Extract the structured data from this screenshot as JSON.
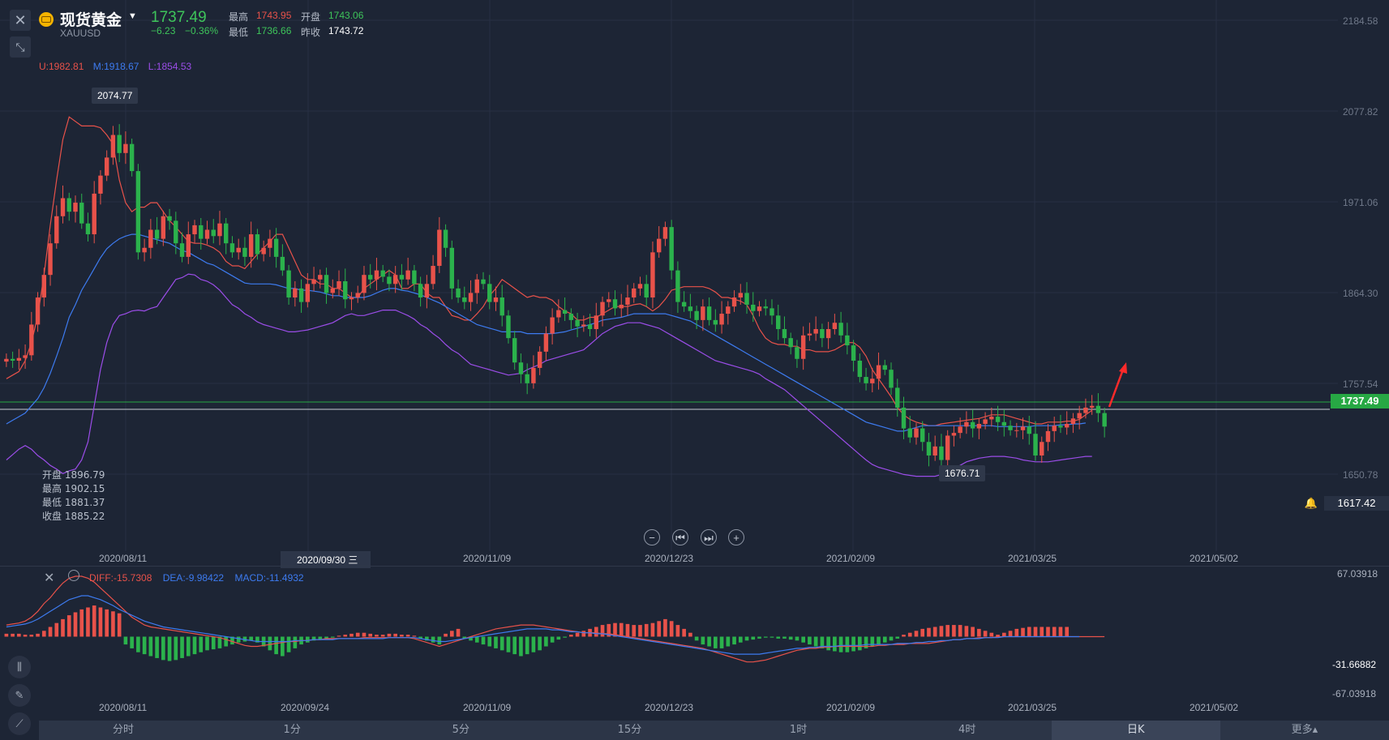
{
  "header": {
    "title": "现货黄金",
    "symbol": "XAUUSD",
    "price": "1737.49",
    "change": "−6.23",
    "change_pct": "−0.36%",
    "stats": [
      {
        "label": "最高",
        "value": "1743.95",
        "color": "#e8524a"
      },
      {
        "label": "开盘",
        "value": "1743.06",
        "color": "#3ec45a"
      },
      {
        "label": "最低",
        "value": "1736.66",
        "color": "#3ec45a"
      },
      {
        "label": "昨收",
        "value": "1743.72",
        "color": "#ffffff"
      }
    ]
  },
  "boll": {
    "upper": "U:1982.81",
    "mid": "M:1918.67",
    "lower": "L:1854.53",
    "colors": {
      "upper": "#e8524a",
      "mid": "#3d7bf0",
      "lower": "#9b4de8"
    }
  },
  "ohlc": {
    "open": "开盘 1896.79",
    "high": "最高 1902.15",
    "low": "最低 1881.37",
    "close": "收盘 1885.22"
  },
  "callouts": {
    "high": "2074.77",
    "low": "1676.71"
  },
  "price_tag": "1737.49",
  "alert_price": "1617.42",
  "y_axis": [
    "2184.58",
    "2077.82",
    "1971.06",
    "1864.30",
    "1757.54",
    "1650.78"
  ],
  "x_axis": [
    "2020/08/11",
    "2020/09/30 三",
    "2020/11/09",
    "2020/12/23",
    "2021/02/09",
    "2021/03/25",
    "2021/05/02"
  ],
  "macd": {
    "diff": "DIFF:-15.7308",
    "dea": "DEA:-9.98422",
    "macd": "MACD:-11.4932",
    "y_axis": [
      "67.03918",
      "-31.66882",
      "-67.03918"
    ],
    "x_axis": [
      "2020/08/11",
      "2020/09/24",
      "2020/11/09",
      "2020/12/23",
      "2021/02/09",
      "2021/03/25",
      "2021/05/02"
    ]
  },
  "tabs": [
    "分时",
    "1分",
    "5分",
    "15分",
    "1时",
    "4时",
    "日K",
    "更多▴"
  ],
  "active_tab": "日K",
  "colors": {
    "up": "#e8524a",
    "down": "#2bb24c",
    "background": "#1d2535"
  },
  "chart_data": {
    "type": "candlestick",
    "ylim": [
      1617,
      2205
    ],
    "closes": [
      1812,
      1810,
      1813,
      1816,
      1850,
      1880,
      1905,
      1940,
      1970,
      1990,
      1975,
      1985,
      1962,
      1950,
      1995,
      2015,
      2035,
      2060,
      2040,
      2050,
      2020,
      1930,
      1935,
      1955,
      1945,
      1970,
      1965,
      1940,
      1925,
      1950,
      1960,
      1945,
      1955,
      1948,
      1962,
      1940,
      1930,
      1935,
      1925,
      1950,
      1928,
      1935,
      1945,
      1925,
      1910,
      1880,
      1890,
      1875,
      1895,
      1900,
      1905,
      1885,
      1890,
      1898,
      1878,
      1880,
      1885,
      1905,
      1900,
      1910,
      1903,
      1895,
      1905,
      1900,
      1910,
      1895,
      1880,
      1895,
      1915,
      1955,
      1935,
      1890,
      1880,
      1875,
      1885,
      1900,
      1895,
      1875,
      1880,
      1860,
      1835,
      1808,
      1795,
      1785,
      1802,
      1820,
      1840,
      1858,
      1866,
      1862,
      1855,
      1848,
      1850,
      1845,
      1860,
      1875,
      1878,
      1868,
      1872,
      1880,
      1890,
      1895,
      1880,
      1930,
      1945,
      1958,
      1910,
      1875,
      1870,
      1865,
      1855,
      1870,
      1855,
      1850,
      1862,
      1870,
      1880,
      1885,
      1872,
      1865,
      1870,
      1868,
      1860,
      1845,
      1835,
      1825,
      1812,
      1838,
      1840,
      1845,
      1835,
      1845,
      1852,
      1838,
      1827,
      1810,
      1792,
      1785,
      1790,
      1805,
      1800,
      1780,
      1758,
      1735,
      1725,
      1735,
      1720,
      1705,
      1715,
      1700,
      1727,
      1730,
      1737,
      1742,
      1735,
      1740,
      1745,
      1748,
      1742,
      1738,
      1733,
      1733,
      1737,
      1729,
      1705,
      1720,
      1732,
      1738,
      1736,
      1740,
      1746,
      1752,
      1758,
      1760,
      1752,
      1737
    ],
    "boll_upper": [
      1790,
      1794,
      1798,
      1810,
      1830,
      1860,
      1905,
      1960,
      2010,
      2055,
      2080,
      2075,
      2070,
      2070,
      2070,
      2068,
      2060,
      2050,
      2010,
      1985,
      1975,
      1980,
      1980,
      1985,
      1985,
      1975,
      1965,
      1958,
      1950,
      1942,
      1940,
      1940,
      1938,
      1935,
      1930,
      1920,
      1915,
      1915,
      1912,
      1920,
      1928,
      1935,
      1942,
      1950,
      1950,
      1935,
      1920,
      1905,
      1900,
      1900,
      1895,
      1895,
      1890,
      1890,
      1885,
      1880,
      1880,
      1890,
      1895,
      1900,
      1905,
      1910,
      1905,
      1890,
      1890,
      1895,
      1895,
      1885,
      1880,
      1880,
      1870,
      1860,
      1858,
      1855,
      1855,
      1862,
      1870,
      1882,
      1890,
      1900,
      1895,
      1890,
      1885,
      1880,
      1882,
      1880,
      1880,
      1877,
      1870,
      1865,
      1862,
      1855,
      1855,
      1858,
      1858,
      1862,
      1866,
      1870,
      1870,
      1870,
      1872,
      1873,
      1870,
      1865,
      1870,
      1878,
      1888,
      1890,
      1892,
      1892,
      1892,
      1892,
      1890,
      1886,
      1880,
      1880,
      1878,
      1876,
      1872,
      1860,
      1845,
      1835,
      1830,
      1828,
      1828,
      1826,
      1826,
      1822,
      1822,
      1820,
      1820,
      1820,
      1822,
      1826,
      1830,
      1830,
      1825,
      1815,
      1800,
      1790,
      1780,
      1770,
      1758,
      1750,
      1745,
      1742,
      1740,
      1738,
      1738,
      1740,
      1741,
      1742,
      1743,
      1744,
      1745,
      1746,
      1748,
      1750,
      1750,
      1750,
      1748,
      1746,
      1744,
      1742,
      1740,
      1740,
      1742,
      1742,
      1742,
      1743,
      1743,
      1745,
      1750,
      1755
    ],
    "boll_mid": [
      1740,
      1744,
      1748,
      1752,
      1760,
      1768,
      1780,
      1796,
      1815,
      1835,
      1858,
      1872,
      1888,
      1900,
      1912,
      1924,
      1934,
      1940,
      1945,
      1948,
      1950,
      1950,
      1948,
      1946,
      1944,
      1942,
      1940,
      1936,
      1932,
      1930,
      1926,
      1922,
      1918,
      1916,
      1912,
      1908,
      1904,
      1900,
      1896,
      1895,
      1895,
      1895,
      1895,
      1894,
      1892,
      1890,
      1890,
      1888,
      1888,
      1887,
      1886,
      1884,
      1882,
      1882,
      1880,
      1880,
      1880,
      1880,
      1882,
      1885,
      1888,
      1890,
      1890,
      1888,
      1887,
      1885,
      1883,
      1880,
      1877,
      1874,
      1870,
      1866,
      1862,
      1858,
      1854,
      1850,
      1848,
      1846,
      1844,
      1842,
      1842,
      1842,
      1842,
      1840,
      1840,
      1840,
      1840,
      1840,
      1841,
      1842,
      1844,
      1846,
      1848,
      1850,
      1852,
      1855,
      1856,
      1857,
      1858,
      1860,
      1862,
      1862,
      1862,
      1862,
      1862,
      1862,
      1860,
      1858,
      1856,
      1854,
      1850,
      1846,
      1842,
      1838,
      1834,
      1830,
      1826,
      1822,
      1818,
      1814,
      1810,
      1806,
      1802,
      1798,
      1794,
      1790,
      1786,
      1782,
      1778,
      1774,
      1770,
      1766,
      1762,
      1758,
      1754,
      1750,
      1746,
      1742,
      1740,
      1738,
      1736,
      1734,
      1732,
      1732,
      1734,
      1736,
      1738,
      1738,
      1738,
      1738,
      1738,
      1738,
      1738,
      1738,
      1738,
      1738,
      1738,
      1738,
      1737,
      1737,
      1737,
      1737,
      1737,
      1737,
      1738,
      1738,
      1738,
      1738,
      1739,
      1739,
      1740,
      1740,
      1741
    ],
    "boll_lower": [
      1700,
      1706,
      1712,
      1716,
      1712,
      1705,
      1700,
      1694,
      1690,
      1685,
      1688,
      1690,
      1700,
      1720,
      1760,
      1800,
      1830,
      1850,
      1860,
      1862,
      1865,
      1866,
      1865,
      1868,
      1870,
      1880,
      1890,
      1900,
      1902,
      1906,
      1905,
      1900,
      1898,
      1894,
      1888,
      1880,
      1872,
      1868,
      1862,
      1858,
      1853,
      1850,
      1848,
      1846,
      1844,
      1842,
      1842,
      1843,
      1844,
      1846,
      1848,
      1850,
      1852,
      1856,
      1860,
      1862,
      1860,
      1860,
      1862,
      1864,
      1866,
      1866,
      1866,
      1863,
      1860,
      1856,
      1850,
      1846,
      1840,
      1835,
      1828,
      1822,
      1818,
      1812,
      1806,
      1804,
      1802,
      1800,
      1798,
      1796,
      1794,
      1795,
      1796,
      1800,
      1803,
      1806,
      1810,
      1812,
      1814,
      1816,
      1818,
      1820,
      1822,
      1828,
      1834,
      1840,
      1844,
      1848,
      1850,
      1852,
      1852,
      1852,
      1850,
      1848,
      1846,
      1842,
      1838,
      1834,
      1830,
      1826,
      1822,
      1818,
      1814,
      1810,
      1808,
      1806,
      1804,
      1802,
      1800,
      1798,
      1795,
      1790,
      1786,
      1782,
      1778,
      1772,
      1766,
      1760,
      1754,
      1748,
      1742,
      1736,
      1730,
      1724,
      1718,
      1712,
      1706,
      1700,
      1695,
      1692,
      1690,
      1688,
      1686,
      1684,
      1683,
      1682,
      1682,
      1682,
      1682,
      1684,
      1686,
      1690,
      1694,
      1698,
      1700,
      1702,
      1703,
      1704,
      1704,
      1704,
      1703,
      1702,
      1700,
      1699,
      1698,
      1698,
      1698,
      1699,
      1700,
      1701,
      1702,
      1703,
      1704,
      1704
    ],
    "macd_hist": [
      3,
      3,
      3,
      2,
      2,
      3,
      6,
      10,
      14,
      18,
      22,
      25,
      28,
      30,
      32,
      30,
      28,
      26,
      24,
      -8,
      -12,
      -16,
      -18,
      -20,
      -22,
      -24,
      -25,
      -24,
      -22,
      -20,
      -18,
      -16,
      -14,
      -13,
      -12,
      -10,
      -8,
      -6,
      -5,
      -4,
      -6,
      -10,
      -14,
      -18,
      -20,
      -16,
      -12,
      -8,
      -6,
      -4,
      -3,
      -2,
      -1,
      1,
      2,
      3,
      4,
      4,
      3,
      2,
      2,
      3,
      3,
      2,
      2,
      1,
      -2,
      -4,
      -6,
      -8,
      3,
      6,
      8,
      -2,
      -4,
      -6,
      -8,
      -10,
      -12,
      -14,
      -16,
      -18,
      -20,
      -18,
      -16,
      -14,
      -10,
      -6,
      -3,
      -1,
      2,
      4,
      6,
      8,
      10,
      12,
      13,
      14,
      14,
      13,
      12,
      12,
      13,
      14,
      16,
      18,
      16,
      12,
      8,
      4,
      -4,
      -8,
      -10,
      -12,
      -12,
      -10,
      -8,
      -6,
      -4,
      -3,
      -2,
      -1,
      -1,
      -2,
      -2,
      -3,
      -4,
      -6,
      -8,
      -10,
      -12,
      -14,
      -15,
      -16,
      -16,
      -15,
      -14,
      -12,
      -10,
      -8,
      -6,
      -4,
      -2,
      2,
      4,
      6,
      8,
      9,
      10,
      11,
      12,
      12,
      12,
      11,
      10,
      8,
      6,
      4,
      2,
      4,
      6,
      8,
      9,
      10,
      10,
      10,
      10,
      10,
      10,
      10
    ],
    "macd_diff": [
      12,
      13,
      14,
      16,
      20,
      26,
      34,
      40,
      48,
      55,
      60,
      62,
      62,
      60,
      56,
      50,
      44,
      38,
      32,
      26,
      20,
      16,
      12,
      10,
      9,
      8,
      7,
      6,
      5,
      4,
      3,
      2,
      1,
      0,
      -1,
      -3,
      -5,
      -7,
      -9,
      -10,
      -10,
      -9,
      -8,
      -7,
      -6,
      -5,
      -5,
      -4,
      -4,
      -3,
      -3,
      -2,
      -2,
      -2,
      -2,
      -2,
      -2,
      -1,
      -1,
      -1,
      -1,
      -1,
      -1,
      -1,
      -1,
      -2,
      -4,
      -6,
      -8,
      -10,
      -8,
      -6,
      -4,
      -2,
      0,
      2,
      4,
      6,
      8,
      9,
      10,
      11,
      12,
      12,
      12,
      11,
      10,
      9,
      8,
      7,
      6,
      5,
      4,
      4,
      4,
      3,
      3,
      2,
      1,
      0,
      -1,
      -2,
      -3,
      -4,
      -5,
      -6,
      -7,
      -8,
      -9,
      -10,
      -11,
      -12,
      -14,
      -16,
      -18,
      -20,
      -22,
      -24,
      -26,
      -26,
      -25,
      -24,
      -22,
      -20,
      -18,
      -16,
      -14,
      -13,
      -12,
      -12,
      -11,
      -11,
      -10,
      -10,
      -10,
      -10,
      -10,
      -10,
      -10,
      -9,
      -9,
      -8,
      -8,
      -8,
      -7,
      -7,
      -7,
      -7,
      -6,
      -5,
      -4,
      -3,
      -3,
      -2,
      -2,
      -1,
      -1,
      -1,
      0,
      0,
      0,
      0,
      0,
      0,
      0,
      0,
      0,
      0,
      0,
      0,
      0,
      0,
      0,
      0,
      0,
      0
    ],
    "macd_dea": [
      10,
      11,
      12,
      13,
      15,
      18,
      22,
      26,
      30,
      34,
      38,
      40,
      42,
      42,
      40,
      38,
      35,
      32,
      28,
      25,
      22,
      19,
      16,
      14,
      12,
      10,
      9,
      8,
      7,
      6,
      5,
      4,
      3,
      2,
      1,
      0,
      -1,
      -2,
      -3,
      -4,
      -5,
      -5,
      -5,
      -5,
      -5,
      -5,
      -4,
      -4,
      -4,
      -3,
      -3,
      -3,
      -3,
      -2,
      -2,
      -2,
      -2,
      -2,
      -2,
      -2,
      -2,
      -1,
      -1,
      -1,
      -1,
      -1,
      -2,
      -3,
      -4,
      -5,
      -5,
      -4,
      -3,
      -2,
      -1,
      0,
      1,
      2,
      3,
      4,
      5,
      6,
      7,
      8,
      8,
      8,
      8,
      7,
      7,
      6,
      5,
      5,
      4,
      4,
      3,
      3,
      2,
      1,
      0,
      -1,
      -2,
      -3,
      -4,
      -5,
      -6,
      -7,
      -8,
      -9,
      -10,
      -11,
      -12,
      -13,
      -14,
      -15,
      -16,
      -17,
      -18,
      -18,
      -18,
      -18,
      -18,
      -17,
      -16,
      -15,
      -14,
      -13,
      -12,
      -12,
      -11,
      -11,
      -10,
      -10,
      -10,
      -9,
      -9,
      -9,
      -9,
      -8,
      -8,
      -8,
      -8,
      -8,
      -7,
      -7,
      -7,
      -6,
      -6,
      -5,
      -5,
      -4,
      -4,
      -3,
      -3,
      -2,
      -2,
      -2,
      -1,
      -1,
      -1,
      0,
      0,
      0,
      0,
      0,
      0,
      0,
      0,
      0,
      0,
      0,
      0,
      0
    ]
  }
}
